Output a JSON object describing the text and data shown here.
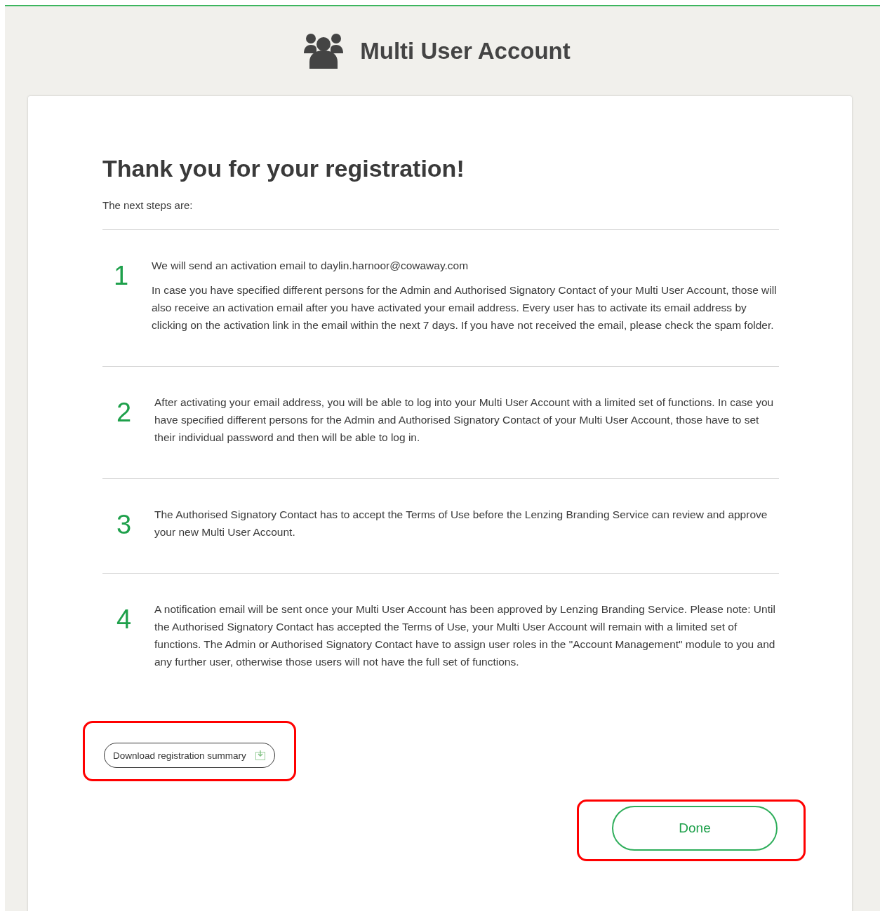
{
  "header": {
    "title": "Multi User Account"
  },
  "card": {
    "heading": "Thank you for your registration!",
    "intro": "The next steps are:",
    "steps": [
      {
        "number": "1",
        "paragraphs": [
          "We will send an activation email to daylin.harnoor@cowaway.com",
          "In case you have specified different persons for the Admin and Authorised Signatory Contact of your Multi User Account, those will also receive an activation email after you have activated your email address. Every user has to activate its email address by clicking on the activation link in the email within the next 7 days. If you have not received the email, please check the spam folder."
        ]
      },
      {
        "number": "2",
        "paragraphs": [
          "After activating your email address, you will be able to log into your Multi User Account with a limited set of functions. In case you have specified different persons for the Admin and Authorised Signatory Contact of your Multi User Account, those have to set their individual password and then will be able to log in."
        ]
      },
      {
        "number": "3",
        "paragraphs": [
          "The Authorised Signatory Contact has to accept the Terms of Use before the Lenzing Branding Service can review and approve your new Multi User Account."
        ]
      },
      {
        "number": "4",
        "paragraphs": [
          "A notification email will be sent once your Multi User Account has been approved by Lenzing Branding Service. Please note: Until the Authorised Signatory Contact has accepted the Terms of Use, your Multi User Account will remain with a limited set of functions. The Admin or Authorised Signatory Contact have to assign user roles in the \"Account Management\" module to you and any further user, otherwise those users will not have the full set of functions."
        ]
      }
    ],
    "download_button": {
      "label": "Download registration summary",
      "highlighted": true
    },
    "done_button": {
      "label": "Done",
      "highlighted": true
    }
  }
}
